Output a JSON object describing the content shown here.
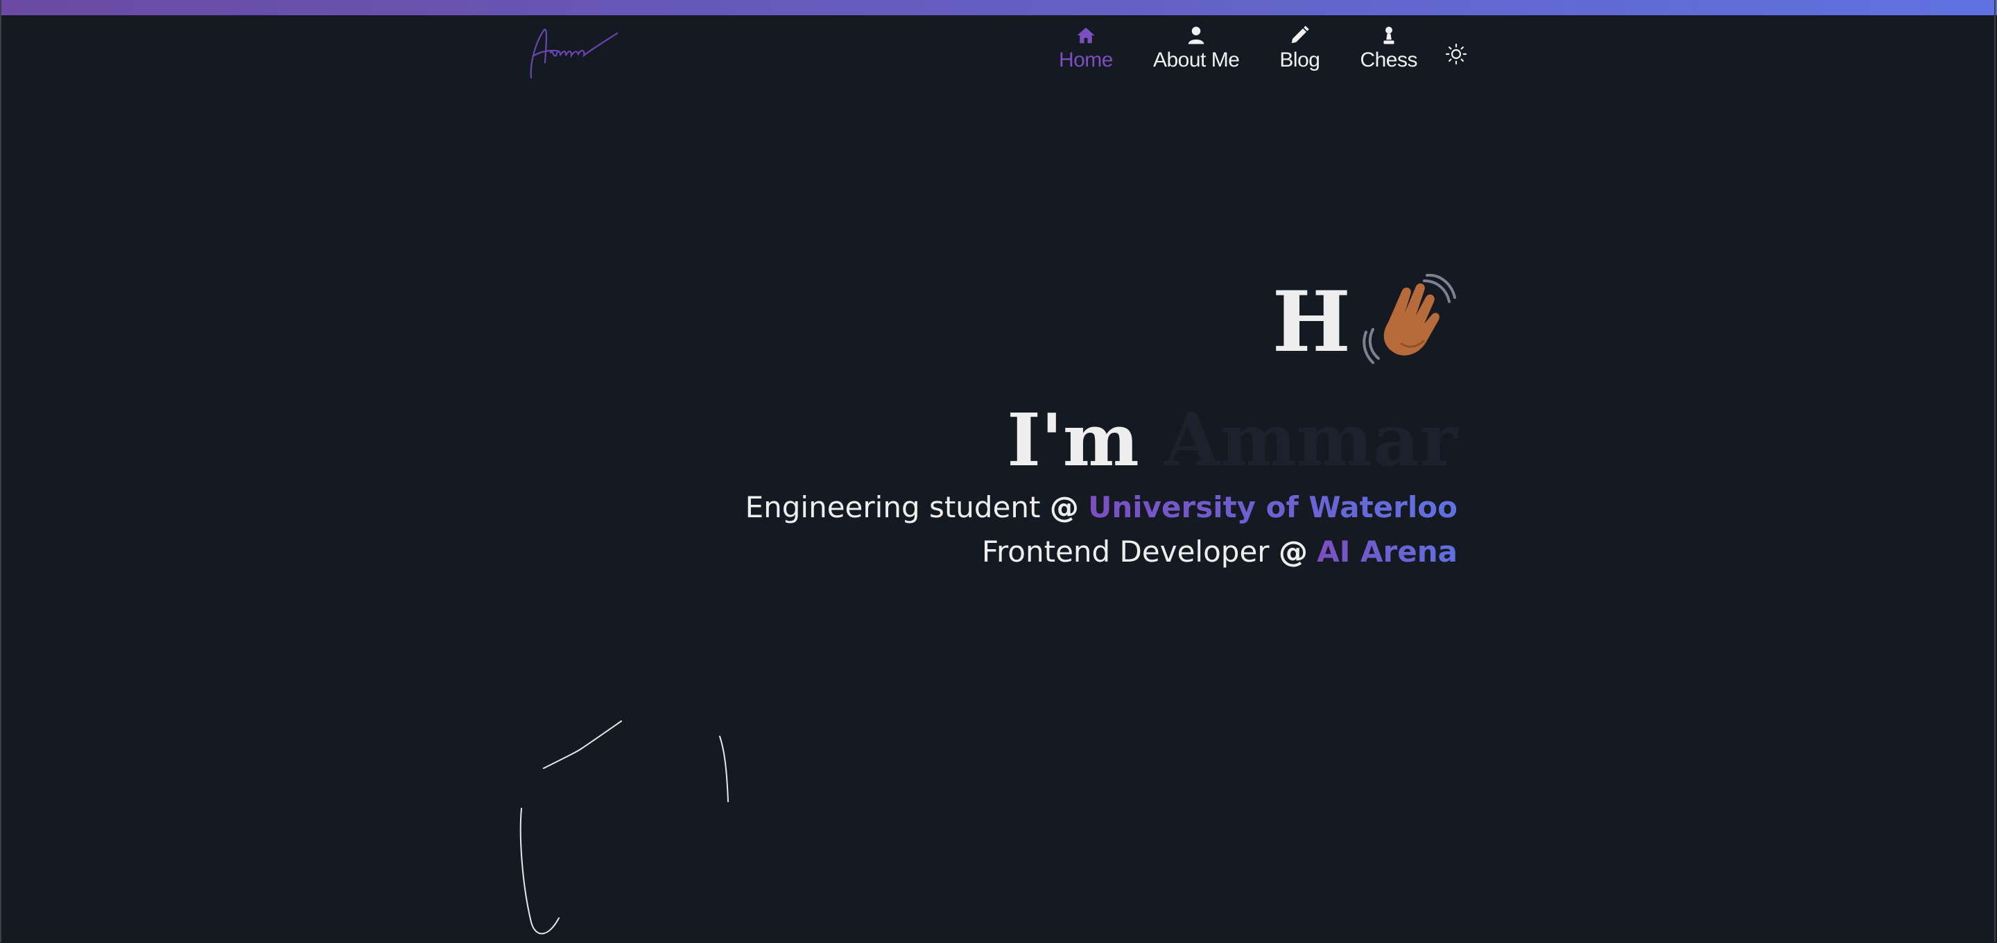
{
  "header": {
    "nav": [
      {
        "label": "Home",
        "icon": "home-icon",
        "active": true
      },
      {
        "label": "About Me",
        "icon": "user-icon",
        "active": false
      },
      {
        "label": "Blog",
        "icon": "pencil-icon",
        "active": false
      },
      {
        "label": "Chess",
        "icon": "chess-pawn-icon",
        "active": false
      }
    ],
    "theme_toggle_icon": "sun-icon"
  },
  "hero": {
    "greeting": "H",
    "greeting_emoji": "waving-hand-icon",
    "intro_prefix": "I'm",
    "intro_name": "Ammar",
    "roles": [
      {
        "text": "Engineering student",
        "at": "@",
        "org": "University of Waterloo"
      },
      {
        "text": "Frontend Developer",
        "at": "@",
        "org": "AI Arena"
      }
    ]
  },
  "colors": {
    "background": "#151922",
    "accent_purple": "#7b4fc0",
    "accent_blue": "#5f72e0",
    "text": "#eeeeee"
  }
}
